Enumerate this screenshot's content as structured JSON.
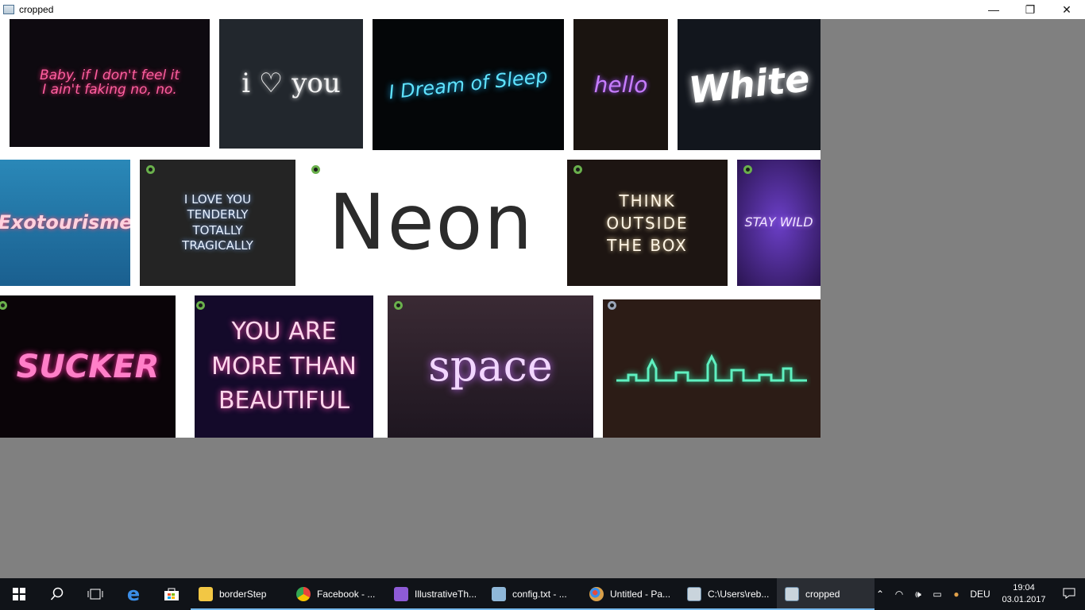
{
  "window": {
    "title": "cropped",
    "minimize": "—",
    "maximize": "❐",
    "close": "✕"
  },
  "tiles": {
    "baby": "Baby, if I don't feel it\nI ain't faking no, no.",
    "iloveyou": "i ♡ you",
    "dream": "I Dream of Sleep",
    "hello": "hello",
    "white": "White",
    "exotourisme": "Exotourisme",
    "lovetender": "I LOVE YOU\nTENDERLY\nTOTALLY\nTRAGICALLY",
    "neon": "Neon",
    "think": "THINK\nOUTSIDE\nTHE BOX",
    "staywild": "STAY WILD",
    "sucker": "SUCKER",
    "youare": "YOU ARE\nMORE THAN\nBEAUTIFUL",
    "space": "space"
  },
  "taskbar": {
    "apps": [
      {
        "label": "borderStep",
        "color": "#f2c744"
      },
      {
        "label": "Facebook - ...",
        "color": "#e8453c"
      },
      {
        "label": "IllustrativeTh...",
        "color": "#8e5bd6"
      },
      {
        "label": "config.txt - ...",
        "color": "#8fb7d8"
      },
      {
        "label": "Untitled - Pa...",
        "color": "#d9a04a"
      },
      {
        "label": "C:\\Users\\reb...",
        "color": "#c9d4dc"
      },
      {
        "label": "cropped",
        "color": "#c9d4dc"
      }
    ],
    "language": "DEU",
    "time": "19:04",
    "date": "03.01.2017"
  }
}
